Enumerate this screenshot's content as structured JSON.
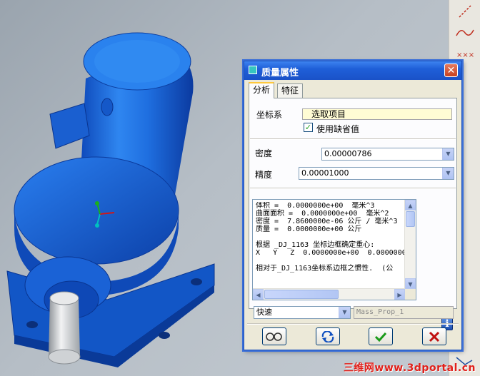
{
  "dialog": {
    "title": "质量属性",
    "tabs": [
      {
        "label": "分析",
        "active": true
      },
      {
        "label": "特征",
        "active": false
      }
    ],
    "coord_label": "坐标系",
    "coord_value": "选取项目",
    "use_default_label": "使用缺省值",
    "use_default_checked": true,
    "density_label": "密度",
    "density_value": "0.00000786",
    "precision_label": "精度",
    "precision_value": "0.00001000",
    "results_lines": [
      "体积 =  0.0000000e+00  毫米^3",
      "曲面面积 =  0.0000000e+00  毫米^2",
      "密度 =  7.8600000e-06 公斤 / 毫米^3",
      "质量 =  0.0000000e+00 公斤",
      "",
      "根据 _DJ_1163 坐标边框确定重心:",
      "X   Y   Z  0.0000000e+00  0.0000000",
      "",
      "相对于_DJ_1163坐标系边框之惯性.  (公"
    ],
    "mode_value": "快速",
    "name_value": "Mass_Prop_1",
    "buttons": {
      "preview": "preview-glasses-icon",
      "repeat": "repeat-arrows-icon",
      "ok": "ok-check-icon",
      "cancel": "cancel-x-icon"
    }
  },
  "watermark": "三维网www.3dportal.cn",
  "colors": {
    "model_blue": "#1f6fe0",
    "title_bar": "#1f5fd8",
    "ok_green": "#1a9a1a",
    "cancel_red": "#c01010"
  }
}
